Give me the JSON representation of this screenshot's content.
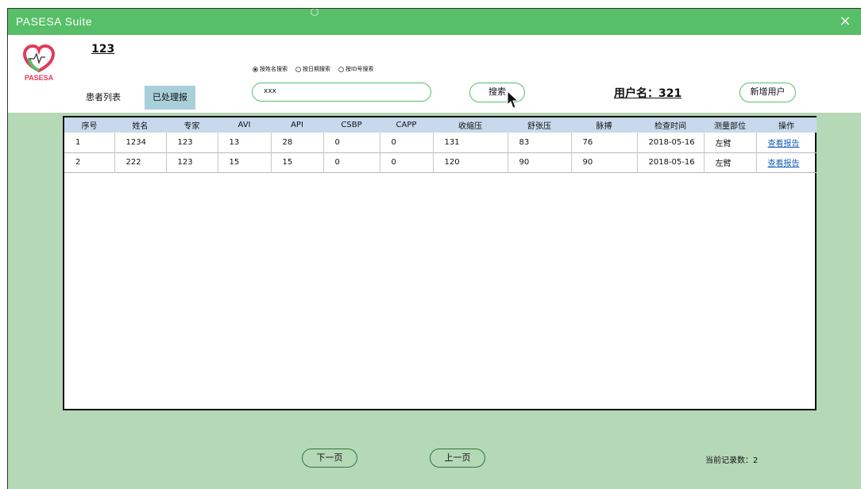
{
  "window": {
    "title": "PASESA Suite",
    "close_icon": "×"
  },
  "header": {
    "logo_text": "PASESA",
    "user_id": "123",
    "tabs": [
      {
        "label": "患者列表"
      },
      {
        "label": "已处理报告"
      }
    ],
    "search_modes": [
      {
        "label": "按姓名搜索",
        "checked": true
      },
      {
        "label": "按日期搜索",
        "checked": false
      },
      {
        "label": "按ID号搜索",
        "checked": false
      }
    ],
    "search_value": "xxx",
    "search_button": "搜索",
    "username": "用户名：321",
    "new_user_button": "新增用户"
  },
  "table": {
    "columns": [
      "序号",
      "姓名",
      "专家",
      "AVI",
      "API",
      "CSBP",
      "CAPP",
      "收缩压",
      "舒张压",
      "脉搏",
      "检查时间",
      "测量部位",
      "操作"
    ],
    "rows": [
      [
        "1",
        "1234",
        "123",
        "13",
        "28",
        "0",
        "0",
        "131",
        "83",
        "76",
        "2018-05-16",
        "左臂",
        "查看报告"
      ],
      [
        "2",
        "222",
        "123",
        "15",
        "15",
        "0",
        "0",
        "120",
        "90",
        "90",
        "2018-05-16",
        "左臂",
        "查看报告"
      ]
    ]
  },
  "footer": {
    "next_page": "下一页",
    "prev_page": "上一页",
    "record_count": "当前记录数：2"
  },
  "colors": {
    "titlebar": "#56bf67",
    "content_bg": "#b5d8b7",
    "active_tab": "#a9cfdb",
    "table_header": "#c8d9ec",
    "link": "#1a5fb4"
  }
}
